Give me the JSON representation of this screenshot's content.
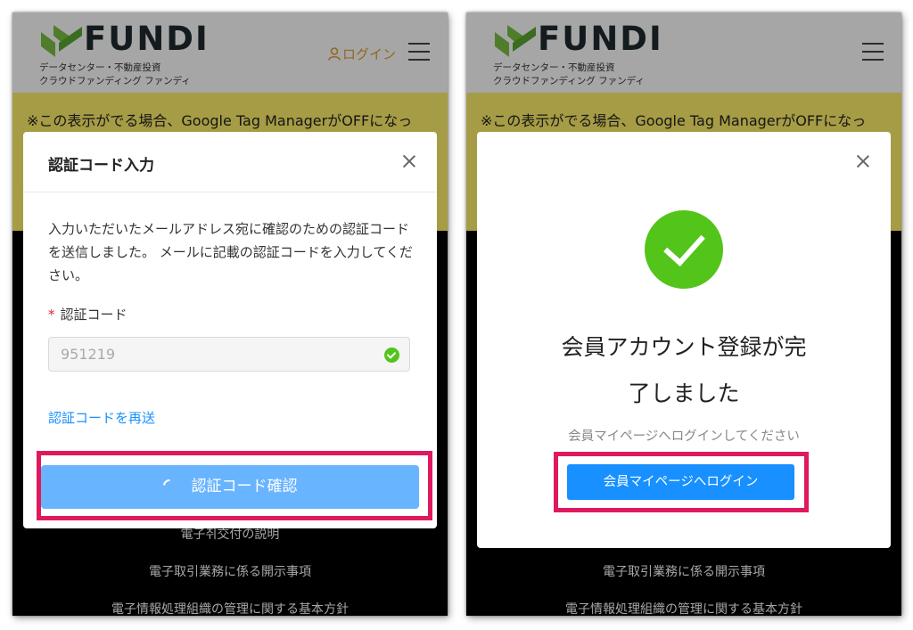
{
  "header": {
    "logo_text": "FUNDI",
    "tagline_line1": "データセンター・不動産投資",
    "tagline_line2": "クラウドファンディング ファンディ",
    "login_label": "ログイン"
  },
  "notice": {
    "text": "※この表示がでる場合、Google Tag ManagerがOFFになっ"
  },
  "footer": {
    "link1": "電子취交付の説明",
    "link2": "電子取引業務に係る開示事項",
    "link3": "電子情報処理組織の管理に関する基本方針"
  },
  "verify_modal": {
    "title": "認証コード入力",
    "description": "入力いただいたメールアドレス宛に確認のための認証コードを送信しました。 メールに記載の認証コードを入力してください。",
    "required_mark": "*",
    "field_label": "認証コード",
    "code_value": "951219",
    "resend_label": "認証コードを再送",
    "confirm_label": "認証コード確認"
  },
  "success_modal": {
    "title_line1": "会員アカウント登録が完",
    "title_line2": "了しました",
    "subtitle": "会員マイページへログインしてください",
    "login_button_label": "会員マイページへログイン"
  },
  "colors": {
    "brand_green": "#52c41a",
    "primary_blue": "#1890ff",
    "highlight_pink": "#e0195f",
    "notice_yellow": "#fff06a"
  }
}
